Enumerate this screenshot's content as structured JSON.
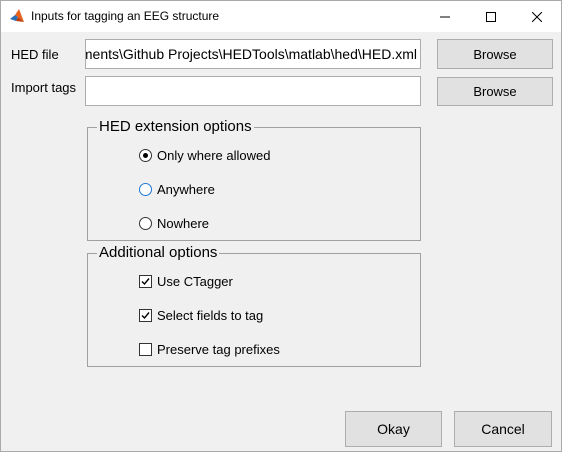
{
  "window": {
    "title": "Inputs for tagging an EEG structure",
    "app_icon": "matlab-icon",
    "controls": [
      "minimize-icon",
      "maximize-icon",
      "close-icon"
    ]
  },
  "hed_file": {
    "label": "HED file",
    "value": "C:\\Users\\kay\\Documents\\Github Projects\\HEDTools\\matlab\\hed\\HED.xml",
    "visible_value": "cuments\\Github Projects\\HEDTools\\matlab\\hed\\HED.xml",
    "browse_label": "Browse"
  },
  "import_tags": {
    "label": "Import tags",
    "value": "",
    "browse_label": "Browse"
  },
  "extension_options": {
    "title": "HED extension options",
    "options": [
      {
        "label": "Only where allowed",
        "selected": true
      },
      {
        "label": "Anywhere",
        "selected": false
      },
      {
        "label": "Nowhere",
        "selected": false
      }
    ]
  },
  "additional_options": {
    "title": "Additional options",
    "options": [
      {
        "label": "Use CTagger",
        "checked": true
      },
      {
        "label": "Select fields to tag",
        "checked": true
      },
      {
        "label": "Preserve tag prefixes",
        "checked": false
      }
    ]
  },
  "footer": {
    "okay_label": "Okay",
    "cancel_label": "Cancel"
  }
}
